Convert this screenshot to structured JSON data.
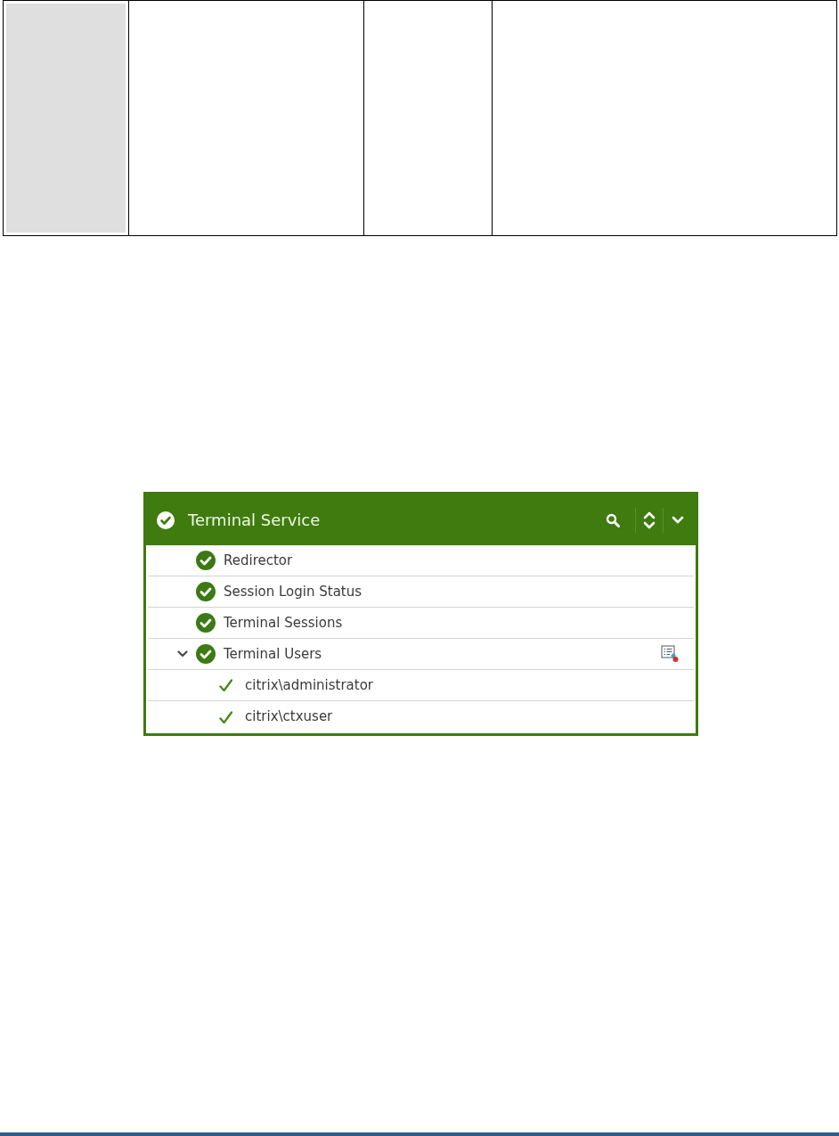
{
  "panel": {
    "title": "Terminal Service",
    "ok": true,
    "items": [
      {
        "label": "Redirector",
        "ok": true
      },
      {
        "label": "Session Login Status",
        "ok": true
      },
      {
        "label": "Terminal Sessions",
        "ok": true
      },
      {
        "label": "Terminal Users",
        "ok": true,
        "expanded": true,
        "report_icon": true,
        "children": [
          {
            "label": "citrix\\administrator",
            "ok": true
          },
          {
            "label": "citrix\\ctxuser",
            "ok": true
          }
        ]
      }
    ]
  }
}
